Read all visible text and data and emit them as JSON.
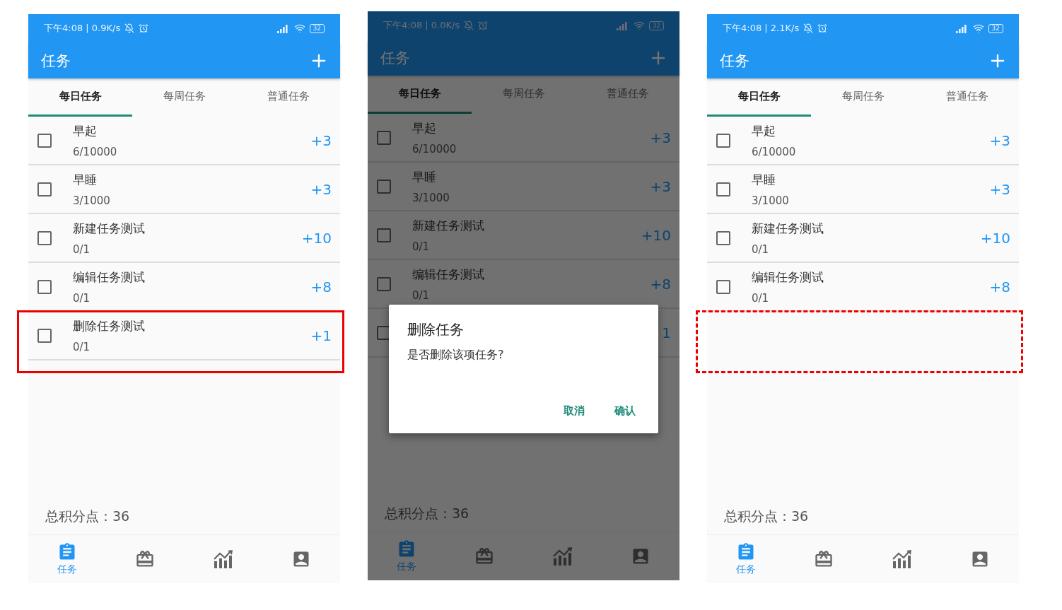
{
  "phones": [
    {
      "status": {
        "text": "下午4:08 | 0.9K/s",
        "battery": "32"
      },
      "title": "任务",
      "dimmed": false,
      "tabs": [
        {
          "label": "每日任务",
          "selected": true
        },
        {
          "label": "每周任务",
          "selected": false
        },
        {
          "label": "普通任务",
          "selected": false
        }
      ],
      "rows": [
        {
          "kind": "task",
          "checked": false,
          "title": "早起",
          "progress": "6/10000",
          "points": "+3"
        },
        {
          "kind": "task",
          "checked": false,
          "title": "早睡",
          "progress": "3/1000",
          "points": "+3"
        },
        {
          "kind": "task",
          "checked": false,
          "title": "新建任务测试",
          "progress": "0/1",
          "points": "+10"
        },
        {
          "kind": "task",
          "checked": false,
          "title": "编辑任务测试",
          "progress": "0/1",
          "points": "+8"
        },
        {
          "kind": "task",
          "checked": false,
          "title": "删除任务测试",
          "progress": "0/1",
          "points": "+1",
          "highlight": {
            "kind": "solid"
          }
        }
      ],
      "total": "总积分点：36",
      "nav": [
        {
          "label": "任务",
          "selected": true
        },
        {
          "selected": false
        },
        {
          "selected": false
        },
        {
          "selected": false
        }
      ]
    },
    {
      "status": {
        "text": "下午4:08 | 0.0K/s",
        "battery": "32"
      },
      "title": "任务",
      "dimmed": true,
      "tabs": [
        {
          "label": "每日任务",
          "selected": true
        },
        {
          "label": "每周任务",
          "selected": false
        },
        {
          "label": "普通任务",
          "selected": false
        }
      ],
      "rows": [
        {
          "kind": "task",
          "checked": false,
          "title": "早起",
          "progress": "6/10000",
          "points": "+3"
        },
        {
          "kind": "task",
          "checked": false,
          "title": "早睡",
          "progress": "3/1000",
          "points": "+3"
        },
        {
          "kind": "task",
          "checked": false,
          "title": "新建任务测试",
          "progress": "0/1",
          "points": "+10"
        },
        {
          "kind": "task",
          "checked": false,
          "title": "编辑任务测试",
          "progress": "0/1",
          "points": "+8"
        },
        {
          "kind": "task",
          "checked": false,
          "points": "1"
        }
      ],
      "total": "总积分点：36",
      "nav": [
        {
          "label": "任务",
          "selected": true
        },
        {
          "selected": false
        },
        {
          "selected": false
        },
        {
          "selected": false
        }
      ],
      "dialog": {
        "title": "删除任务",
        "message": "是否删除该项任务?",
        "buttons": [
          "取消",
          "确认"
        ]
      }
    },
    {
      "status": {
        "text": "下午4:08 | 2.1K/s",
        "battery": "32"
      },
      "title": "任务",
      "dimmed": false,
      "tabs": [
        {
          "label": "每日任务",
          "selected": true
        },
        {
          "label": "每周任务",
          "selected": false
        },
        {
          "label": "普通任务",
          "selected": false
        }
      ],
      "rows": [
        {
          "kind": "task",
          "checked": false,
          "title": "早起",
          "progress": "6/10000",
          "points": "+3"
        },
        {
          "kind": "task",
          "checked": false,
          "title": "早睡",
          "progress": "3/1000",
          "points": "+3"
        },
        {
          "kind": "task",
          "checked": false,
          "title": "新建任务测试",
          "progress": "0/1",
          "points": "+10"
        },
        {
          "kind": "task",
          "checked": false,
          "title": "编辑任务测试",
          "progress": "0/1",
          "points": "+8"
        },
        {
          "kind": "empty",
          "highlight": {
            "kind": "dashed"
          }
        }
      ],
      "total": "总积分点：36",
      "nav": [
        {
          "label": "任务",
          "selected": true
        },
        {
          "selected": false
        },
        {
          "selected": false
        },
        {
          "selected": false
        }
      ]
    }
  ]
}
